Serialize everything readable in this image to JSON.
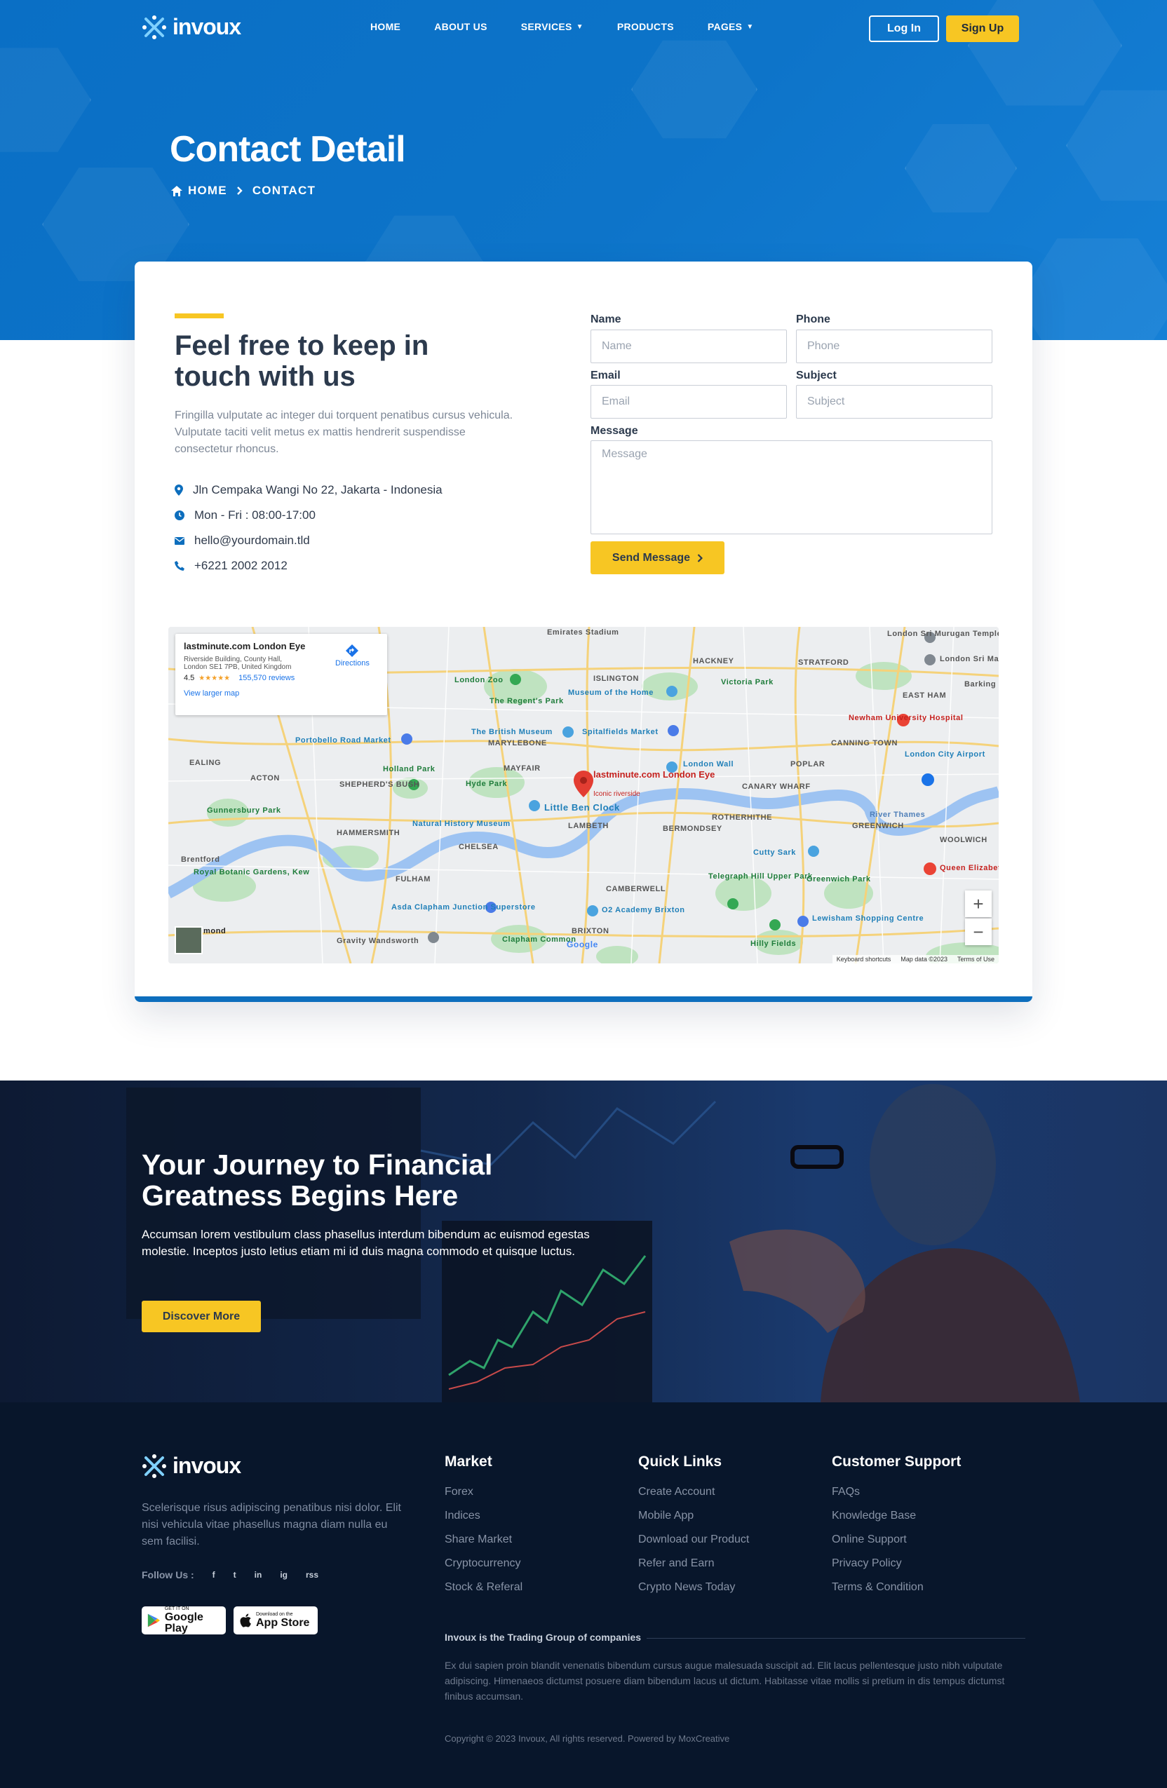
{
  "brand": {
    "name": "invoux"
  },
  "nav": {
    "links": [
      {
        "label": "HOME"
      },
      {
        "label": "ABOUT US"
      },
      {
        "label": "SERVICES",
        "dropdown": true
      },
      {
        "label": "PRODUCTS"
      },
      {
        "label": "PAGES",
        "dropdown": true
      }
    ],
    "login_label": "Log In",
    "signup_label": "Sign Up"
  },
  "hero": {
    "title": "Contact Detail",
    "breadcrumb": [
      "HOME",
      "CONTACT"
    ]
  },
  "contact": {
    "title": "Feel free to keep in touch with us",
    "description": "Fringilla vulputate ac integer dui torquent penatibus cursus vehicula. Vulputate taciti velit metus ex mattis hendrerit suspendisse consectetur rhoncus.",
    "address": "Jln Cempaka Wangi No 22, Jakarta - Indonesia",
    "hours": "Mon - Fri : 08:00-17:00",
    "email": "hello@yourdomain.tld",
    "phone": "+6221 2002 2012"
  },
  "form": {
    "name_label": "Name",
    "name_placeholder": "Name",
    "phone_label": "Phone",
    "phone_placeholder": "Phone",
    "email_label": "Email",
    "email_placeholder": "Email",
    "subject_label": "Subject",
    "subject_placeholder": "Subject",
    "message_label": "Message",
    "message_placeholder": "Message",
    "send_label": "Send Message"
  },
  "map": {
    "place_name": "lastminute.com London Eye",
    "address_line1": "Riverside Building, County Hall,",
    "address_line2": "London SE1 7PB, United Kingdom",
    "rating": "4.5",
    "stars": "★★★★★",
    "reviews": "155,570 reviews",
    "directions": "Directions",
    "larger_map": "View larger map",
    "pin_label": "lastminute.com London Eye",
    "pin_sub": "Iconic riverside",
    "labels": [
      "Emirates Stadium",
      "HACKNEY",
      "STRATFORD",
      "London Zoo",
      "ISLINGTON",
      "Victoria Park",
      "EAST HAM",
      "Museum of the Home",
      "The Regent's Park",
      "The British Museum",
      "Spitalfields Market",
      "Portobello Road Market",
      "MARYLEBONE",
      "London Wall",
      "EALING",
      "ACTON",
      "SHEPHERD'S BUSH",
      "Holland Park",
      "Hyde Park",
      "MAYFAIR",
      "Little Ben Clock",
      "CANARY WHARF",
      "POPLAR",
      "Gunnersbury Park",
      "HAMMERSMITH",
      "Natural History Museum",
      "ROTHERHITHE",
      "GREENWICH",
      "BERMONDSEY",
      "LAMBETH",
      "CHELSEA",
      "Brentford",
      "Royal Botanic Gardens, Kew",
      "FULHAM",
      "CAMBERWELL",
      "Cutty Sark",
      "Telegraph Hill Upper Park",
      "Greenwich Park",
      "Asda Clapham Junction Superstore",
      "O2 Academy Brixton",
      "Lewisham Shopping Centre",
      "Gravity Wandsworth",
      "Clapham Common",
      "BRIXTON",
      "Hilly Fields",
      "London Sri Murugan Temple",
      "London Sri Mahalakshmi",
      "Barking",
      "Newham University Hospital",
      "London City Airport",
      "WOOLWICH",
      "Queen Elizabeth",
      "CANNING TOWN",
      "River Thames",
      "mond"
    ],
    "footer_items": [
      "Keyboard shortcuts",
      "Map data ©2023",
      "Terms of Use"
    ],
    "google": "Google",
    "zoom_in": "+",
    "zoom_out": "−"
  },
  "cta": {
    "title": "Your Journey to Financial Greatness Begins Here",
    "description": "Accumsan lorem vestibulum class phasellus interdum bibendum ac euismod egestas molestie. Inceptos justo letius etiam mi id duis magna commodo et quisque luctus.",
    "button": "Discover More"
  },
  "footer": {
    "description": "Scelerisque risus adipiscing penatibus nisi dolor. Elit nisi vehicula vitae phasellus magna diam nulla eu sem facilisi.",
    "follow_label": "Follow Us :",
    "social": [
      "f",
      "t",
      "in",
      "ig",
      "rss"
    ],
    "google_play_small": "GET IT ON",
    "google_play_big": "Google Play",
    "app_store_small": "Download on the",
    "app_store_big": "App Store",
    "columns": [
      {
        "title": "Market",
        "links": [
          "Forex",
          "Indices",
          "Share Market",
          "Cryptocurrency",
          "Stock & Referal"
        ]
      },
      {
        "title": "Quick Links",
        "links": [
          "Create Account",
          "Mobile App",
          "Download our Product",
          "Refer and Earn",
          "Crypto News Today"
        ]
      },
      {
        "title": "Customer Support",
        "links": [
          "FAQs",
          "Knowledge Base",
          "Online Support",
          "Privacy Policy",
          "Terms & Condition"
        ]
      }
    ],
    "group_title": "Invoux is the Trading Group of companies",
    "group_text": "Ex dui sapien proin blandit venenatis bibendum cursus augue malesuada suscipit ad. Elit lacus pellentesque justo nibh vulputate adipiscing. Himenaeos dictumst posuere diam bibendum lacus ut dictum. Habitasse vitae mollis si pretium in dis tempus dictumst finibus accumsan.",
    "copyright": "Copyright © 2023 Invoux, All rights reserved. Powered by MoxCreative"
  },
  "colors": {
    "primary": "#0d6ebd",
    "accent": "#f7c623",
    "footer_bg": "#08162b",
    "text_dark": "#2c3a4d"
  }
}
